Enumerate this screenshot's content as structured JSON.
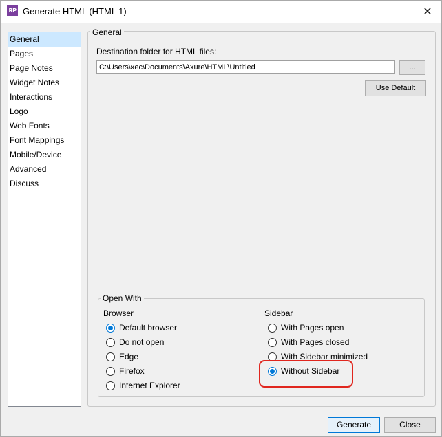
{
  "window": {
    "title": "Generate HTML (HTML 1)",
    "app_icon_text": "RP",
    "close_glyph": "✕"
  },
  "sidebar": {
    "items": [
      {
        "label": "General",
        "selected": true
      },
      {
        "label": "Pages"
      },
      {
        "label": "Page Notes"
      },
      {
        "label": "Widget Notes"
      },
      {
        "label": "Interactions"
      },
      {
        "label": "Logo"
      },
      {
        "label": "Web Fonts"
      },
      {
        "label": "Font Mappings"
      },
      {
        "label": "Mobile/Device"
      },
      {
        "label": "Advanced"
      },
      {
        "label": "Discuss"
      }
    ]
  },
  "general": {
    "group_label": "General",
    "dest_label": "Destination folder for HTML files:",
    "dest_value": "C:\\Users\\xec\\Documents\\Axure\\HTML\\Untitled",
    "browse_label": "...",
    "use_default_label": "Use Default"
  },
  "open_with": {
    "group_label": "Open With",
    "browser_heading": "Browser",
    "browser_options": [
      {
        "label": "Default browser",
        "checked": true
      },
      {
        "label": "Do not open",
        "checked": false
      },
      {
        "label": "Edge",
        "checked": false
      },
      {
        "label": "Firefox",
        "checked": false
      },
      {
        "label": "Internet Explorer",
        "checked": false
      }
    ],
    "sidebar_heading": "Sidebar",
    "sidebar_options": [
      {
        "label": "With Pages open",
        "checked": false
      },
      {
        "label": "With Pages closed",
        "checked": false
      },
      {
        "label": "With Sidebar minimized",
        "checked": false
      },
      {
        "label": "Without Sidebar",
        "checked": true
      }
    ]
  },
  "footer": {
    "generate_label": "Generate",
    "close_label": "Close"
  },
  "colors": {
    "accent": "#0078d7",
    "selection": "#cce8ff",
    "highlight": "#e0261e",
    "app_icon": "#7b3f9e"
  }
}
